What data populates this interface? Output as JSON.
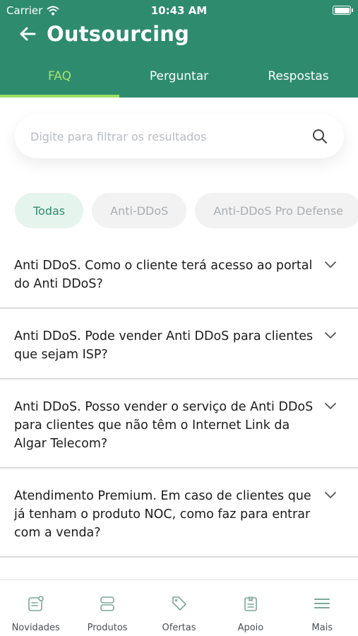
{
  "status": {
    "carrier": "Carrier",
    "time": "10:43 AM"
  },
  "header": {
    "title": "Outsourcing"
  },
  "tabs": [
    {
      "label": "FAQ",
      "active": true
    },
    {
      "label": "Perguntar",
      "active": false
    },
    {
      "label": "Respostas",
      "active": false
    }
  ],
  "search": {
    "placeholder": "Digite para filtrar os resultados"
  },
  "chips": [
    {
      "label": "Todas",
      "active": true
    },
    {
      "label": "Anti-DDoS",
      "active": false
    },
    {
      "label": "Anti-DDoS Pro Defense",
      "active": false
    }
  ],
  "faq": [
    {
      "question": "Anti DDoS. Como o cliente terá acesso ao portal do Anti DDoS?"
    },
    {
      "question": "Anti DDoS. Pode vender Anti DDoS para clientes que sejam ISP?"
    },
    {
      "question": "Anti DDoS. Posso vender o serviço de Anti DDoS para clientes que não têm o Internet Link da Algar Telecom?"
    },
    {
      "question": "Atendimento Premium. Em caso de clientes que já tenham o produto NOC, como faz para entrar com a venda?"
    }
  ],
  "bottom_nav": [
    {
      "label": "Novidades",
      "icon": "news-icon"
    },
    {
      "label": "Produtos",
      "icon": "products-icon"
    },
    {
      "label": "Ofertas",
      "icon": "tag-icon"
    },
    {
      "label": "Apoio",
      "icon": "support-icon"
    },
    {
      "label": "Mais",
      "icon": "menu-icon"
    }
  ],
  "colors": {
    "header": "#2e8b6e",
    "tab_active": "#9be063",
    "chip_active_bg": "#e6f4ee"
  }
}
